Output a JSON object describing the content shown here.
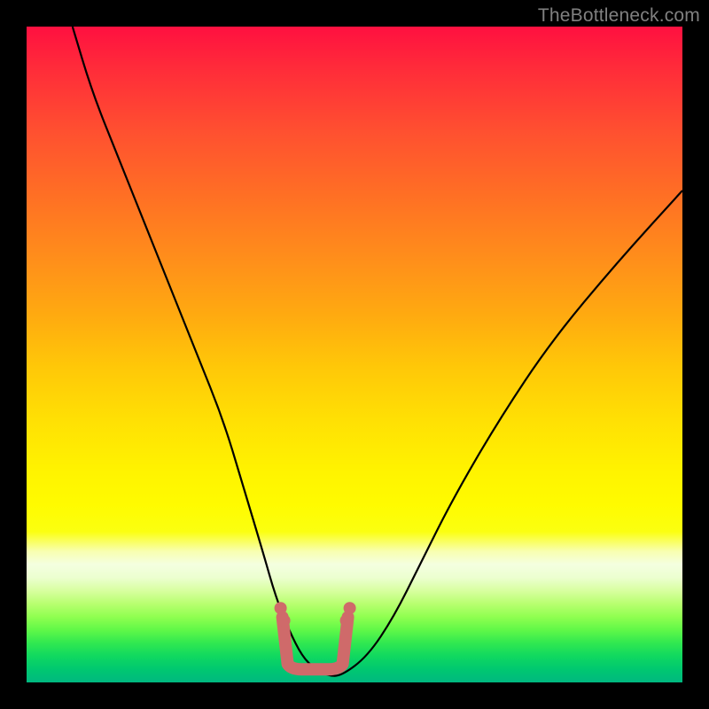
{
  "watermark": "TheBottleneck.com",
  "chart_data": {
    "type": "line",
    "title": "",
    "xlabel": "",
    "ylabel": "",
    "xlim": [
      0,
      100
    ],
    "ylim": [
      0,
      100
    ],
    "series": [
      {
        "name": "curve",
        "x": [
          7,
          10,
          14,
          18,
          22,
          26,
          30,
          33,
          36,
          38,
          40,
          42,
          44,
          46,
          48,
          52,
          56,
          60,
          65,
          72,
          80,
          90,
          100
        ],
        "values": [
          100,
          90,
          80,
          70,
          60,
          50,
          40,
          30,
          20,
          13,
          8,
          4,
          2,
          1,
          1,
          4,
          10,
          18,
          28,
          40,
          52,
          64,
          75
        ]
      }
    ],
    "bottom_marker": {
      "name": "bottom-range",
      "x_start": 39,
      "x_end": 49,
      "y": 2
    }
  },
  "colors": {
    "curve": "#000000",
    "marker": "#cf6a6a",
    "watermark": "#808080"
  }
}
